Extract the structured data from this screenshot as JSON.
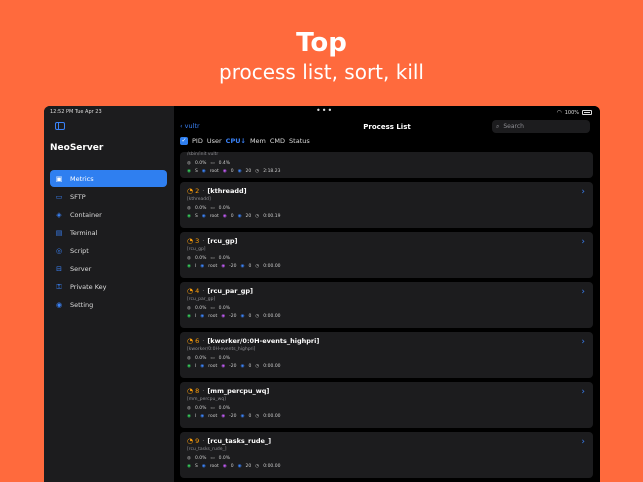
{
  "promo": {
    "title": "Top",
    "subtitle": "process list, sort, kill"
  },
  "status_bar": {
    "time": "12:52 PM   Tue Apr 23",
    "dots": "•••",
    "battery": "100%"
  },
  "sidebar": {
    "app_name": "NeoServer",
    "items": [
      {
        "label": "Metrics",
        "icon": "metrics-icon",
        "glyph": "▣",
        "active": true
      },
      {
        "label": "SFTP",
        "icon": "folder-icon",
        "glyph": "▭"
      },
      {
        "label": "Container",
        "icon": "cube-icon",
        "glyph": "◈"
      },
      {
        "label": "Terminal",
        "icon": "terminal-icon",
        "glyph": "▤"
      },
      {
        "label": "Script",
        "icon": "script-icon",
        "glyph": "◎"
      },
      {
        "label": "Server",
        "icon": "server-icon",
        "glyph": "⊟"
      },
      {
        "label": "Private Key",
        "icon": "key-icon",
        "glyph": "⚿"
      },
      {
        "label": "Setting",
        "icon": "gear-icon",
        "glyph": "◉"
      }
    ]
  },
  "header": {
    "back_label": "vultr",
    "title": "Process List",
    "search_placeholder": "Search"
  },
  "sort": {
    "options": [
      "PID",
      "User",
      "CPU↓",
      "Mem",
      "CMD",
      "Status"
    ],
    "active": "CPU↓"
  },
  "processes": [
    {
      "partial": true,
      "cmd": "/sbin/init vultr",
      "cpu": "0.0%",
      "mem": "0.4%",
      "state": "S",
      "user": "root",
      "nice": "0",
      "prio": "20",
      "time": "2:18.23"
    },
    {
      "pid": "2",
      "name": "[kthreadd]",
      "cmd": "[kthreadd]",
      "cpu": "0.0%",
      "mem": "0.0%",
      "state": "S",
      "user": "root",
      "nice": "0",
      "prio": "20",
      "time": "0:00.19"
    },
    {
      "pid": "3",
      "name": "[rcu_gp]",
      "cmd": "[rcu_gp]",
      "cpu": "0.0%",
      "mem": "0.0%",
      "state": "I",
      "user": "root",
      "nice": "-20",
      "prio": "0",
      "time": "0:00.00"
    },
    {
      "pid": "4",
      "name": "[rcu_par_gp]",
      "cmd": "[rcu_par_gp]",
      "cpu": "0.0%",
      "mem": "0.0%",
      "state": "I",
      "user": "root",
      "nice": "-20",
      "prio": "0",
      "time": "0:00.00"
    },
    {
      "pid": "6",
      "name": "[kworker/0:0H-events_highpri]",
      "cmd": "[kworker/0:0H-events_highpri]",
      "cpu": "0.0%",
      "mem": "0.0%",
      "state": "I",
      "user": "root",
      "nice": "-20",
      "prio": "0",
      "time": "0:00.00"
    },
    {
      "pid": "8",
      "name": "[mm_percpu_wq]",
      "cmd": "[mm_percpu_wq]",
      "cpu": "0.0%",
      "mem": "0.0%",
      "state": "I",
      "user": "root",
      "nice": "-20",
      "prio": "0",
      "time": "0:00.00"
    },
    {
      "pid": "9",
      "name": "[rcu_tasks_rude_]",
      "cmd": "[rcu_tasks_rude_]",
      "cpu": "0.0%",
      "mem": "0.0%",
      "state": "S",
      "user": "root",
      "nice": "0",
      "prio": "20",
      "time": "0:00.00"
    }
  ]
}
